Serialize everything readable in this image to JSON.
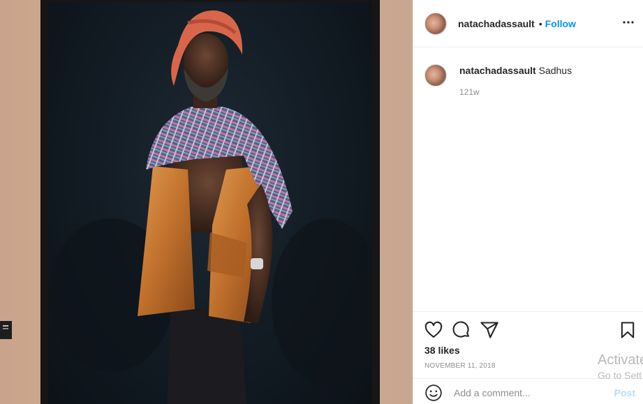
{
  "media": {
    "alt_subject": "framed-portrait-photograph",
    "colors": {
      "wall": "#c9a48b",
      "frame": "#171614",
      "backdrop": "#121b23",
      "turban": "#d9664a",
      "jacket": "#c8762e",
      "shawl": "#7e6f97"
    }
  },
  "header": {
    "username": "natachadassault",
    "separator": "•",
    "follow_label": "Follow",
    "more_icon": "more-horizontal-icon"
  },
  "caption": {
    "username": "natachadassault",
    "text": "Sadhus",
    "age": "121w"
  },
  "actions": {
    "like_icon": "heart-icon",
    "comment_icon": "comment-bubble-icon",
    "share_icon": "paper-plane-icon",
    "save_icon": "bookmark-icon",
    "likes": "38 likes",
    "date": "NOVEMBER 11, 2018"
  },
  "comment_bar": {
    "emoji_icon": "smiley-icon",
    "placeholder": "Add a comment...",
    "post_label": "Post"
  },
  "overlay": {
    "line1": "Activate",
    "line2": "Go to Sett"
  },
  "accent": {
    "link_blue": "#0095f6",
    "post_disabled": "#b2dffc",
    "text": "#262626",
    "muted": "#8e8e8e"
  }
}
